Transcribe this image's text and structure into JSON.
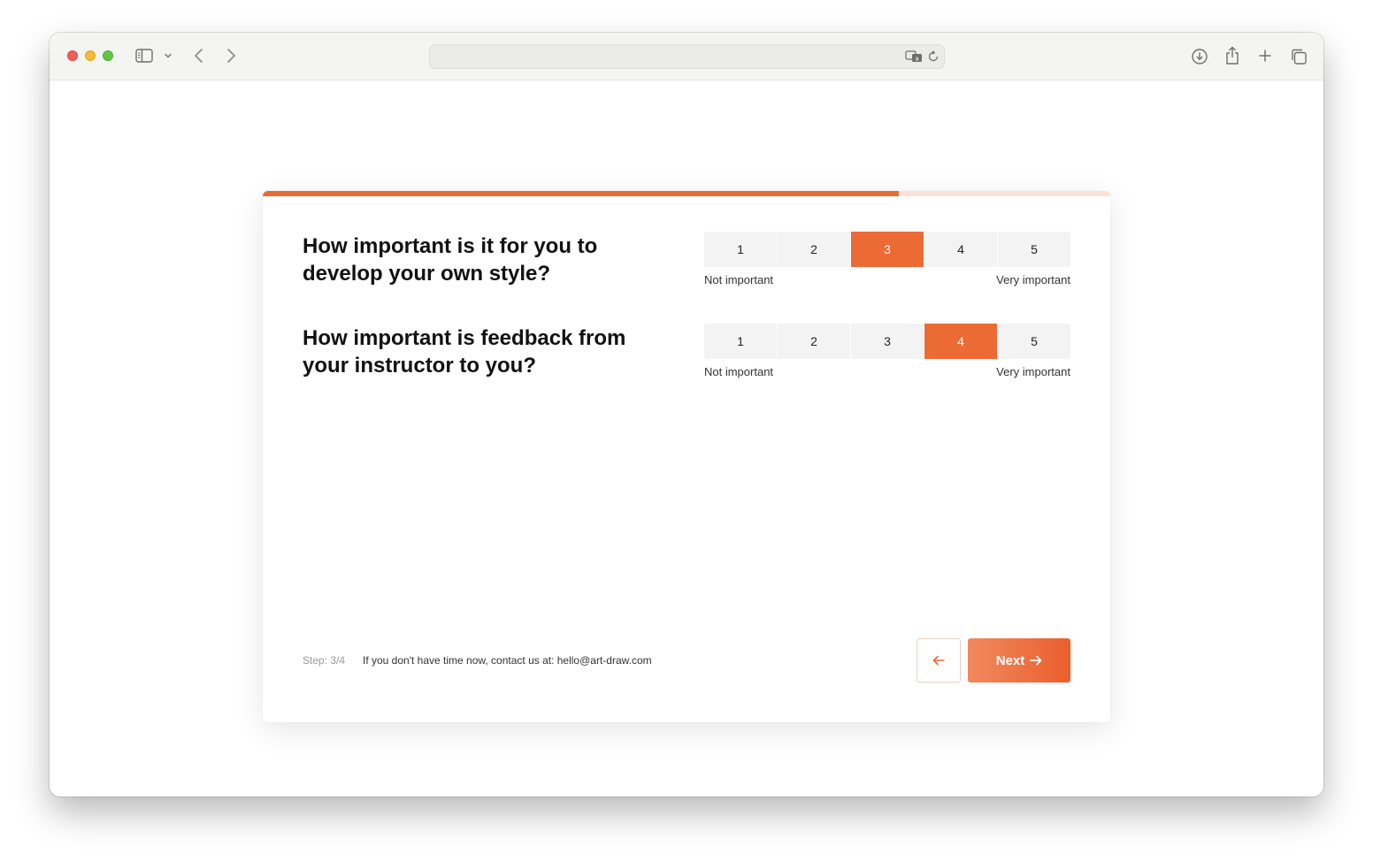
{
  "browser": {
    "address_value": "",
    "icons": [
      "sidebar-icon",
      "chevron-down-icon",
      "back-arrow-icon",
      "forward-arrow-icon",
      "translate-icon",
      "reload-icon",
      "download-icon",
      "share-icon",
      "plus-icon",
      "tabs-icon"
    ]
  },
  "survey": {
    "progress_percent": 75,
    "accent_color": "#ec6a34",
    "questions": [
      {
        "text": "How important is it for you to develop your own style?",
        "options": [
          "1",
          "2",
          "3",
          "4",
          "5"
        ],
        "selected": "3",
        "min_label": "Not important",
        "max_label": "Very important"
      },
      {
        "text": "How important is feedback from your instructor to you?",
        "options": [
          "1",
          "2",
          "3",
          "4",
          "5"
        ],
        "selected": "4",
        "min_label": "Not important",
        "max_label": "Very important"
      }
    ],
    "footer": {
      "step": "Step: 3/4",
      "contact": "If you don't have time now, contact us at: hello@art-draw.com",
      "next_label": "Next"
    }
  }
}
